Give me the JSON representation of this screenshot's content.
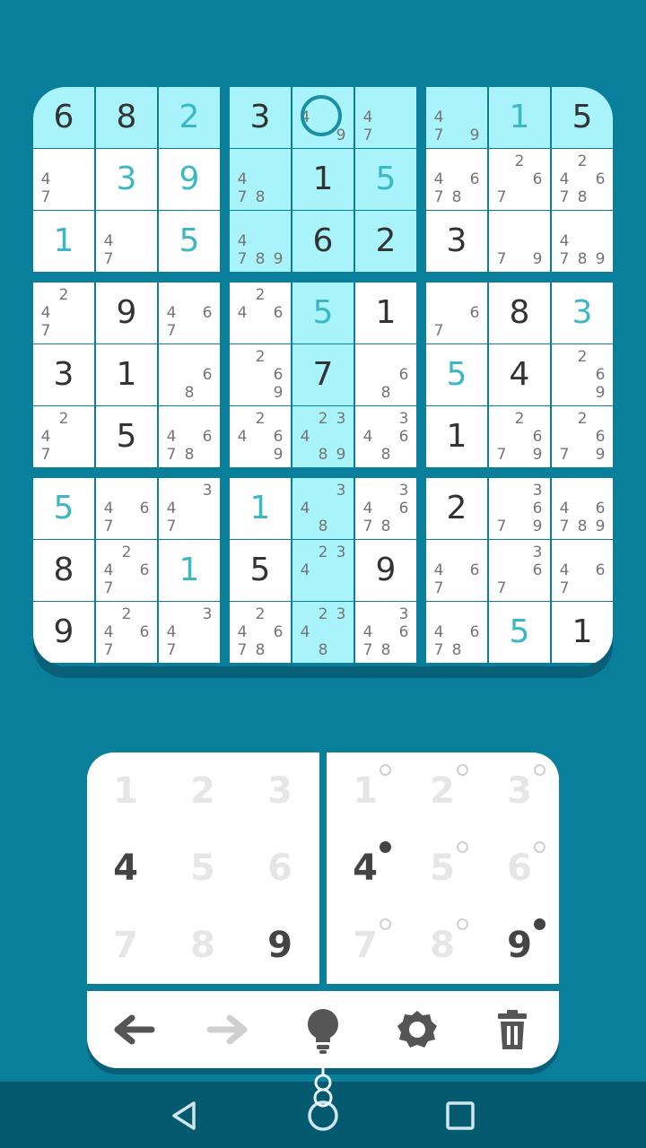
{
  "board": {
    "rows": [
      [
        {
          "v": "6",
          "t": "given"
        },
        {
          "v": "8",
          "t": "given"
        },
        {
          "v": "2",
          "t": "user"
        },
        {
          "v": "3",
          "t": "given"
        },
        {
          "n": [
            4,
            9
          ]
        },
        {
          "n": [
            4,
            7
          ]
        },
        {
          "n": [
            4,
            7,
            9
          ]
        },
        {
          "v": "1",
          "t": "user"
        },
        {
          "v": "5",
          "t": "given"
        }
      ],
      [
        {
          "n": [
            4,
            7
          ]
        },
        {
          "v": "3",
          "t": "user"
        },
        {
          "v": "9",
          "t": "user"
        },
        {
          "n": [
            4,
            7,
            8
          ]
        },
        {
          "v": "1",
          "t": "given"
        },
        {
          "v": "5",
          "t": "user"
        },
        {
          "n": [
            4,
            6,
            7,
            8
          ]
        },
        {
          "n": [
            2,
            6,
            7
          ]
        },
        {
          "n": [
            2,
            4,
            6,
            7,
            8
          ]
        }
      ],
      [
        {
          "v": "1",
          "t": "user"
        },
        {
          "n": [
            4,
            7
          ]
        },
        {
          "v": "5",
          "t": "user"
        },
        {
          "n": [
            4,
            7,
            8,
            9
          ]
        },
        {
          "v": "6",
          "t": "given"
        },
        {
          "v": "2",
          "t": "given"
        },
        {
          "v": "3",
          "t": "given"
        },
        {
          "n": [
            7,
            9
          ]
        },
        {
          "n": [
            4,
            7,
            8,
            9
          ]
        }
      ],
      [
        {
          "n": [
            2,
            4,
            7
          ]
        },
        {
          "v": "9",
          "t": "given"
        },
        {
          "n": [
            4,
            6,
            7
          ]
        },
        {
          "n": [
            2,
            4,
            6
          ]
        },
        {
          "v": "5",
          "t": "user"
        },
        {
          "v": "1",
          "t": "given"
        },
        {
          "n": [
            6,
            7
          ]
        },
        {
          "v": "8",
          "t": "given"
        },
        {
          "v": "3",
          "t": "user"
        }
      ],
      [
        {
          "v": "3",
          "t": "given"
        },
        {
          "v": "1",
          "t": "given"
        },
        {
          "n": [
            6,
            8
          ]
        },
        {
          "n": [
            2,
            6,
            9
          ]
        },
        {
          "v": "7",
          "t": "given"
        },
        {
          "n": [
            6,
            8
          ]
        },
        {
          "v": "5",
          "t": "user"
        },
        {
          "v": "4",
          "t": "given"
        },
        {
          "n": [
            2,
            6,
            9
          ]
        }
      ],
      [
        {
          "n": [
            2,
            4,
            7
          ]
        },
        {
          "v": "5",
          "t": "given"
        },
        {
          "n": [
            4,
            6,
            7,
            8
          ]
        },
        {
          "n": [
            2,
            4,
            6,
            9
          ]
        },
        {
          "n": [
            2,
            3,
            4,
            8,
            9
          ]
        },
        {
          "n": [
            3,
            4,
            6,
            8
          ]
        },
        {
          "v": "1",
          "t": "given"
        },
        {
          "n": [
            2,
            6,
            7,
            9
          ]
        },
        {
          "n": [
            2,
            6,
            7,
            9
          ]
        }
      ],
      [
        {
          "v": "5",
          "t": "user"
        },
        {
          "n": [
            4,
            6,
            7
          ]
        },
        {
          "n": [
            3,
            4,
            7
          ]
        },
        {
          "v": "1",
          "t": "user"
        },
        {
          "n": [
            3,
            4,
            8
          ]
        },
        {
          "n": [
            3,
            4,
            6,
            7,
            8
          ]
        },
        {
          "v": "2",
          "t": "given"
        },
        {
          "n": [
            3,
            6,
            7,
            9
          ]
        },
        {
          "n": [
            4,
            6,
            7,
            8,
            9
          ]
        }
      ],
      [
        {
          "v": "8",
          "t": "given"
        },
        {
          "n": [
            2,
            4,
            6,
            7
          ]
        },
        {
          "v": "1",
          "t": "user"
        },
        {
          "v": "5",
          "t": "given"
        },
        {
          "n": [
            2,
            3,
            4
          ]
        },
        {
          "v": "9",
          "t": "given"
        },
        {
          "n": [
            4,
            6,
            7
          ]
        },
        {
          "n": [
            3,
            6,
            7
          ]
        },
        {
          "n": [
            4,
            6,
            7
          ]
        }
      ],
      [
        {
          "v": "9",
          "t": "given"
        },
        {
          "n": [
            2,
            4,
            6,
            7
          ]
        },
        {
          "n": [
            3,
            4,
            7
          ]
        },
        {
          "n": [
            2,
            4,
            6,
            7,
            8
          ]
        },
        {
          "n": [
            2,
            3,
            4,
            8
          ]
        },
        {
          "n": [
            3,
            4,
            6,
            7,
            8
          ]
        },
        {
          "n": [
            4,
            6,
            7,
            8
          ]
        },
        {
          "v": "5",
          "t": "user"
        },
        {
          "v": "1",
          "t": "given"
        }
      ]
    ],
    "selected": {
      "row": 0,
      "col": 4
    }
  },
  "value_pad": {
    "keys": [
      {
        "label": "1",
        "enabled": false
      },
      {
        "label": "2",
        "enabled": false
      },
      {
        "label": "3",
        "enabled": false
      },
      {
        "label": "4",
        "enabled": true
      },
      {
        "label": "5",
        "enabled": false
      },
      {
        "label": "6",
        "enabled": false
      },
      {
        "label": "7",
        "enabled": false
      },
      {
        "label": "8",
        "enabled": false
      },
      {
        "label": "9",
        "enabled": true
      }
    ]
  },
  "notes_pad": {
    "keys": [
      {
        "label": "1",
        "marked": false
      },
      {
        "label": "2",
        "marked": false
      },
      {
        "label": "3",
        "marked": false
      },
      {
        "label": "4",
        "marked": true
      },
      {
        "label": "5",
        "marked": false
      },
      {
        "label": "6",
        "marked": false
      },
      {
        "label": "7",
        "marked": false
      },
      {
        "label": "8",
        "marked": false
      },
      {
        "label": "9",
        "marked": true
      }
    ]
  },
  "toolbar": {
    "icons": [
      "undo-arrow-icon",
      "redo-arrow-icon",
      "hint-bulb-icon",
      "settings-gear-icon",
      "trash-icon"
    ],
    "active_color": "#555555",
    "disabled_color": "#cfcfcf"
  },
  "colors": {
    "background": "#0a7f9c",
    "highlight": "#a9f3fb",
    "given_digit": "#333333",
    "user_digit": "#3cb8c4",
    "note_digit": "#757575"
  }
}
